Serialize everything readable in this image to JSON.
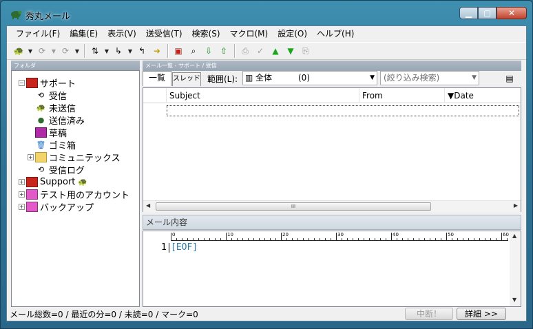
{
  "window": {
    "title": "秀丸メール"
  },
  "menu": [
    "ファイル(F)",
    "編集(E)",
    "表示(V)",
    "送受信(T)",
    "検索(S)",
    "マクロ(M)",
    "設定(O)",
    "ヘルプ(H)"
  ],
  "toolbar": {
    "icons": [
      "turtle-icon",
      "receive-icon",
      "send-icon",
      "sync-icon",
      "reply-icon",
      "forward-icon",
      "new-mail-icon",
      "search-icon",
      "search-next-icon",
      "search-prev-icon",
      "mark-icon",
      "check-icon",
      "up-icon",
      "down-icon",
      "print-icon"
    ]
  },
  "folder_pane": {
    "header": "フォルダ",
    "tree": [
      {
        "label": "サポート",
        "icon": "mailbox-red-icon",
        "expander": "−",
        "level": 0
      },
      {
        "label": "受信",
        "icon": "inbox-icon",
        "level": 1
      },
      {
        "label": "未送信",
        "icon": "outbox-icon",
        "level": 1
      },
      {
        "label": "送信済み",
        "icon": "sent-icon",
        "level": 1
      },
      {
        "label": "草稿",
        "icon": "draft-icon",
        "level": 1
      },
      {
        "label": "ゴミ箱",
        "icon": "trash-icon",
        "level": 1
      },
      {
        "label": "コミュニテックス",
        "icon": "folder-icon",
        "expander": "+",
        "level": 1
      },
      {
        "label": "受信ログ",
        "icon": "log-icon",
        "level": 1
      },
      {
        "label": "Support",
        "icon": "mailbox-red-icon",
        "expander": "+",
        "level": 0
      },
      {
        "label": "テスト用のアカウント",
        "icon": "mailbox-pink-icon",
        "expander": "+",
        "level": 0
      },
      {
        "label": "バックアップ",
        "icon": "mailbox-pink-icon",
        "expander": "+",
        "level": 0
      }
    ]
  },
  "list_pane": {
    "breadcrumb": "メール一覧 - サポート / 受信",
    "tabs": [
      "一覧",
      "スレッド"
    ],
    "range_label": "範囲(L):",
    "range_value": "全体",
    "range_count": "(0)",
    "filter_placeholder": "(絞り込み検索)",
    "columns": [
      "Subject",
      "From",
      "▼Date"
    ],
    "scroll_grip": "III"
  },
  "content_pane": {
    "header": "メール内容",
    "ruler_marks": [
      "0",
      "10",
      "20",
      "30",
      "40",
      "50",
      "60"
    ],
    "line_number": "1",
    "eof": "[EOF]"
  },
  "status": {
    "text": "メール総数=0 / 最近の分=0 / 未読=0 / マーク=0",
    "abort_button": "中断！",
    "detail_button": "詳細 >>"
  }
}
